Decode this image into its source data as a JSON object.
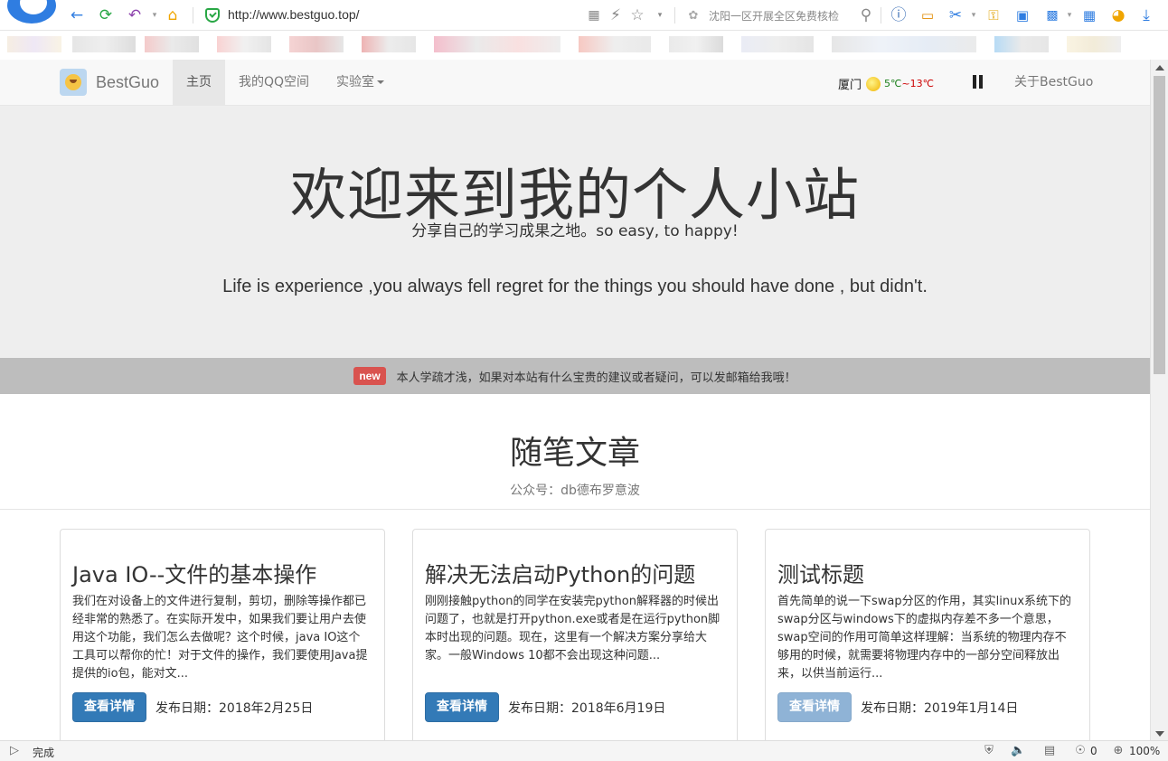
{
  "browser": {
    "url": "http://www.bestguo.top/",
    "search_hint": "沈阳一区开展全区免费核检",
    "status_text": "完成",
    "ad_count": "0",
    "zoom": "100%"
  },
  "navbar": {
    "brand": "BestGuo",
    "items": [
      {
        "label": "主页",
        "active": true
      },
      {
        "label": "我的QQ空间",
        "active": false
      },
      {
        "label": "实验室",
        "active": false
      }
    ],
    "weather_city": "厦门",
    "weather_low": "5℃",
    "weather_sep": "~",
    "weather_high": "13℃",
    "about": "关于BestGuo"
  },
  "hero": {
    "title": "欢迎来到我的个人小站",
    "subtitle": "分享自己的学习成果之地。so easy, to happy!",
    "quote": "Life is experience ,you always fell regret for the things you should have done , but didn't."
  },
  "notice": {
    "badge": "new",
    "text": "本人学疏才浅，如果对本站有什么宝贵的建议或者疑问，可以发邮箱给我哦！"
  },
  "section": {
    "title": "随笔文章",
    "subtitle": "公众号：db德布罗意波"
  },
  "cards": [
    {
      "title": "Java IO--文件的基本操作",
      "excerpt": "我们在对设备上的文件进行复制，剪切，删除等操作都已经非常的熟悉了。在实际开发中，如果我们要让用户去使用这个功能，我们怎么去做呢？这个时候，java IO这个工具可以帮你的忙！对于文件的操作，我们要使用Java提提供的io包，能对文...",
      "button": "查看详情",
      "date": "发布日期：2018年2月25日"
    },
    {
      "title": "解决无法启动Python的问题",
      "excerpt": "刚刚接触python的同学在安装完python解释器的时候出问题了，也就是打开python.exe或者是在运行python脚本时出现的问题。现在，这里有一个解决方案分享给大家。一般Windows 10都不会出现这种问题...",
      "button": "查看详情",
      "date": "发布日期：2018年6月19日"
    },
    {
      "title": "测试标题",
      "excerpt": "首先简单的说一下swap分区的作用，其实linux系统下的swap分区与windows下的虚拟内存差不多一个意思，swap空间的作用可简单这样理解：当系统的物理内存不够用的时候，就需要将物理内存中的一部分空间释放出来，以供当前运行...",
      "button": "查看详情",
      "date": "发布日期：2019年1月14日"
    }
  ],
  "colors": {
    "primary_button": "#337ab7",
    "badge": "#d9534f",
    "jumbotron_bg": "#eeeeee",
    "notice_bg": "#bdbdbd"
  }
}
